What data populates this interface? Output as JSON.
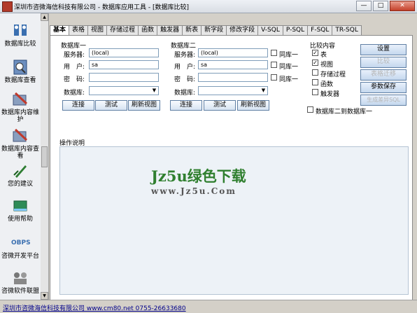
{
  "window": {
    "title": "深圳市咨微海信科技有限公司 - 数据库应用工具 - [数据库比较]",
    "minimize": "—",
    "maximize": "□",
    "close": "✕"
  },
  "sidebar": {
    "items": [
      {
        "label": "数据库比较",
        "icon": "database-compare-icon"
      },
      {
        "label": "数据库查看",
        "icon": "database-view-icon"
      },
      {
        "label": "数据库内容维护",
        "icon": "database-maintain-icon"
      },
      {
        "label": "数据库内容查看",
        "icon": "database-content-view-icon"
      },
      {
        "label": "您的建议",
        "icon": "suggestion-icon"
      },
      {
        "label": "使用帮助",
        "icon": "help-book-icon"
      },
      {
        "label": "咨微开发平台",
        "icon": "obps-icon",
        "icon_text": "OBPS"
      },
      {
        "label": "咨微软件联盟",
        "icon": "alliance-icon"
      }
    ]
  },
  "tabs": [
    "基本",
    "表格",
    "视图",
    "存储过程",
    "函数",
    "触发器",
    "新表",
    "新字段",
    "修改字段",
    "V-SQL",
    "P-SQL",
    "F-SQL",
    "TR-SQL"
  ],
  "db1": {
    "title": "数据库一",
    "server_label": "服务器:",
    "server_value": "(local)",
    "user_label": "用　户:",
    "user_value": "sa",
    "password_label": "密　码:",
    "password_value": "",
    "database_label": "数据库:",
    "database_value": "",
    "connect": "连接",
    "test": "测试",
    "refresh": "刷新视图"
  },
  "db2": {
    "title": "数据库二",
    "server_label": "服务器:",
    "server_value": "(local)",
    "user_label": "用　户:",
    "user_value": "sa",
    "password_label": "密　码:",
    "password_value": "",
    "database_label": "数据库:",
    "database_value": "",
    "same_as_db1": "同库一",
    "connect": "连接",
    "test": "测试",
    "refresh": "刷新视图"
  },
  "compare": {
    "title": "比较内容",
    "options": [
      {
        "label": "表",
        "checked": true
      },
      {
        "label": "视图",
        "checked": true
      },
      {
        "label": "存储过程",
        "checked": false
      },
      {
        "label": "函数",
        "checked": false
      },
      {
        "label": "触发器",
        "checked": false
      }
    ],
    "db2_to_db1": "数据库二到数据库一"
  },
  "actions": {
    "settings": "设置",
    "compare": "比较",
    "table_migrate": "表格迁移",
    "save_params": "参数保存",
    "generate_sql": "生成差异SQL"
  },
  "operation": {
    "label": "操作说明",
    "watermark_main": "Jz5u绿色下载",
    "watermark_url": "www.Jz5u.Com"
  },
  "status": {
    "text": "深圳市咨微海信科技有限公司 www.cm80.net 0755-26633680"
  }
}
